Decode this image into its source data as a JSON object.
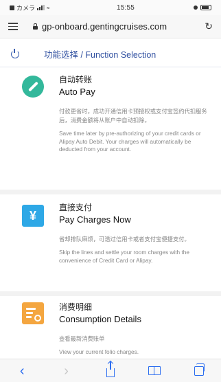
{
  "status_bar": {
    "carrier": "カメラ",
    "time": "15:55"
  },
  "address_bar": {
    "url": "gp-onboard.gentingcruises.com"
  },
  "header": {
    "title": "功能选择 / Function Selection"
  },
  "cards": [
    {
      "title_cn": "自动转账",
      "title_en": "Auto Pay",
      "desc_cn": "付款更省时，成功开通信用卡预授权或支付宝签约代扣服务后，消费金额将从账户中自动扣除。",
      "desc_en": "Save time later by pre-authorizing of your credit cards or Alipay Auto Debit. Your charges will automatically be deducted from your account."
    },
    {
      "title_cn": "直接支付",
      "title_en": "Pay Charges Now",
      "icon_glyph": "¥",
      "desc_cn": "省却排队麻烦，可透过信用卡或者支付宝便捷支付。",
      "desc_en": "Skip the lines and settle your room charges with the convenience of Credit Card or Alipay."
    },
    {
      "title_cn": "消费明细",
      "title_en": "Consumption Details",
      "desc_cn": "查看最新消费账单",
      "desc_en": "View your current folio charges."
    }
  ],
  "colors": {
    "accent_blue": "#2f4fa0",
    "autopay_green": "#33b89b",
    "paynow_blue": "#2ea8e6",
    "consume_orange": "#f4a640",
    "toolbar_blue": "#2d6ef0"
  }
}
